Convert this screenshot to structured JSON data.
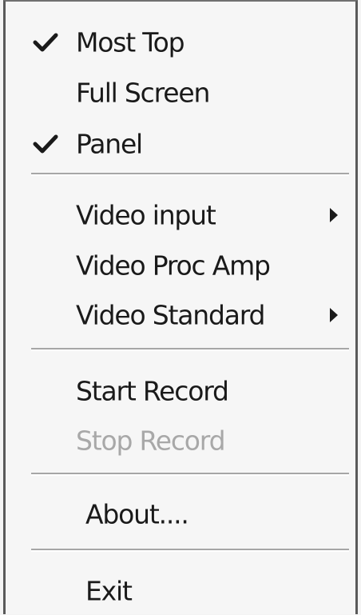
{
  "menu": {
    "items": [
      {
        "label": "Most Top",
        "checked": true
      },
      {
        "label": "Full Screen",
        "checked": false
      },
      {
        "label": "Panel",
        "checked": true
      },
      {
        "label": "Video input",
        "submenu": true
      },
      {
        "label": "Video Proc Amp"
      },
      {
        "label": "Video Standard",
        "submenu": true
      },
      {
        "label": "Start Record"
      },
      {
        "label": "Stop Record",
        "disabled": true
      },
      {
        "label": "About...."
      },
      {
        "label": "Exit"
      }
    ]
  },
  "icons": {
    "check": "check-icon",
    "submenu_arrow": "chevron-right-icon"
  },
  "colors": {
    "text": "#1a1a1a",
    "disabled_text": "#a8a8a8",
    "background": "#f6f6f6",
    "border": "#5a5a5a"
  }
}
